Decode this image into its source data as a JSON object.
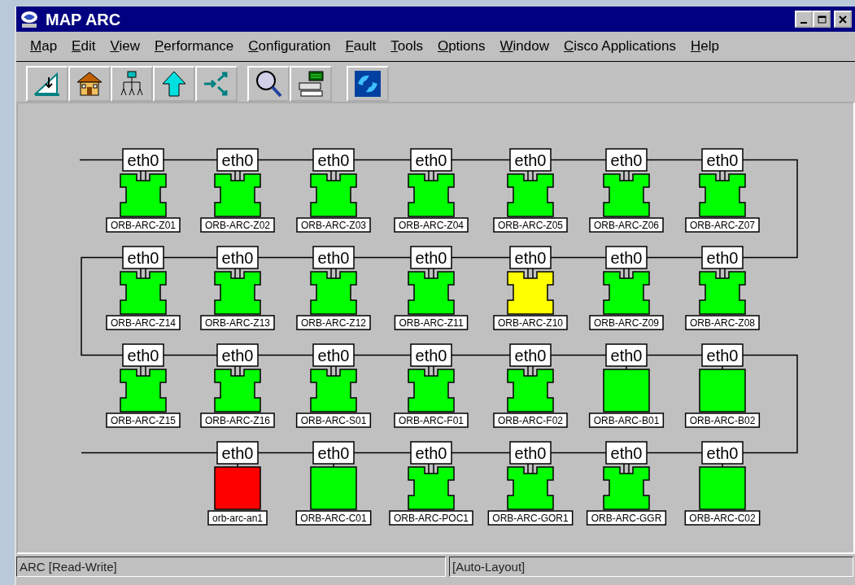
{
  "window": {
    "title": "MAP ARC"
  },
  "menu": [
    {
      "label": "Map"
    },
    {
      "label": "Edit"
    },
    {
      "label": "View"
    },
    {
      "label": "Performance"
    },
    {
      "label": "Configuration"
    },
    {
      "label": "Fault"
    },
    {
      "label": "Tools"
    },
    {
      "label": "Options"
    },
    {
      "label": "Window"
    },
    {
      "label": "Cisco Applications"
    },
    {
      "label": "Help"
    }
  ],
  "map": {
    "rows": [
      [
        {
          "interface": "eth0",
          "name": "ORB-ARC-Z01",
          "kind": "router",
          "color": "#00ff00"
        },
        {
          "interface": "eth0",
          "name": "ORB-ARC-Z02",
          "kind": "router",
          "color": "#00ff00"
        },
        {
          "interface": "eth0",
          "name": "ORB-ARC-Z03",
          "kind": "router",
          "color": "#00ff00"
        },
        {
          "interface": "eth0",
          "name": "ORB-ARC-Z04",
          "kind": "router",
          "color": "#00ff00"
        },
        {
          "interface": "eth0",
          "name": "ORB-ARC-Z05",
          "kind": "router",
          "color": "#00ff00"
        },
        {
          "interface": "eth0",
          "name": "ORB-ARC-Z06",
          "kind": "router",
          "color": "#00ff00"
        },
        {
          "interface": "eth0",
          "name": "ORB-ARC-Z07",
          "kind": "router",
          "color": "#00ff00"
        }
      ],
      [
        {
          "interface": "eth0",
          "name": "ORB-ARC-Z14",
          "kind": "router",
          "color": "#00ff00"
        },
        {
          "interface": "eth0",
          "name": "ORB-ARC-Z13",
          "kind": "router",
          "color": "#00ff00"
        },
        {
          "interface": "eth0",
          "name": "ORB-ARC-Z12",
          "kind": "router",
          "color": "#00ff00"
        },
        {
          "interface": "eth0",
          "name": "ORB-ARC-Z11",
          "kind": "router",
          "color": "#00ff00"
        },
        {
          "interface": "eth0",
          "name": "ORB-ARC-Z10",
          "kind": "router",
          "color": "#ffff00"
        },
        {
          "interface": "eth0",
          "name": "ORB-ARC-Z09",
          "kind": "router",
          "color": "#00ff00"
        },
        {
          "interface": "eth0",
          "name": "ORB-ARC-Z08",
          "kind": "router",
          "color": "#00ff00"
        }
      ],
      [
        {
          "interface": "eth0",
          "name": "ORB-ARC-Z15",
          "kind": "router",
          "color": "#00ff00"
        },
        {
          "interface": "eth0",
          "name": "ORB-ARC-Z16",
          "kind": "router",
          "color": "#00ff00"
        },
        {
          "interface": "eth0",
          "name": "ORB-ARC-S01",
          "kind": "router",
          "color": "#00ff00"
        },
        {
          "interface": "eth0",
          "name": "ORB-ARC-F01",
          "kind": "router",
          "color": "#00ff00"
        },
        {
          "interface": "eth0",
          "name": "ORB-ARC-F02",
          "kind": "router",
          "color": "#00ff00"
        },
        {
          "interface": "eth0",
          "name": "ORB-ARC-B01",
          "kind": "box",
          "color": "#00ff00"
        },
        {
          "interface": "eth0",
          "name": "ORB-ARC-B02",
          "kind": "box",
          "color": "#00ff00"
        }
      ],
      [
        "",
        {
          "interface": "eth0",
          "name": "orb-arc-an1",
          "kind": "box",
          "color": "#ff0000"
        },
        {
          "interface": "eth0",
          "name": "ORB-ARC-C01",
          "kind": "box",
          "color": "#00ff00"
        },
        {
          "interface": "eth0",
          "name": "ORB-ARC-POC1",
          "kind": "router",
          "color": "#00ff00"
        },
        {
          "interface": "eth0",
          "name": "ORB-ARC-GOR1",
          "kind": "router",
          "color": "#00ff00"
        },
        {
          "interface": "eth0",
          "name": "ORB-ARC-GGR",
          "kind": "router",
          "color": "#00ff00"
        },
        {
          "interface": "eth0",
          "name": "ORB-ARC-C02",
          "kind": "box",
          "color": "#00ff00"
        }
      ]
    ]
  },
  "status_bar": [
    {
      "text": "ARC [Read-Write]"
    },
    {
      "text": "[Auto-Layout]"
    }
  ]
}
